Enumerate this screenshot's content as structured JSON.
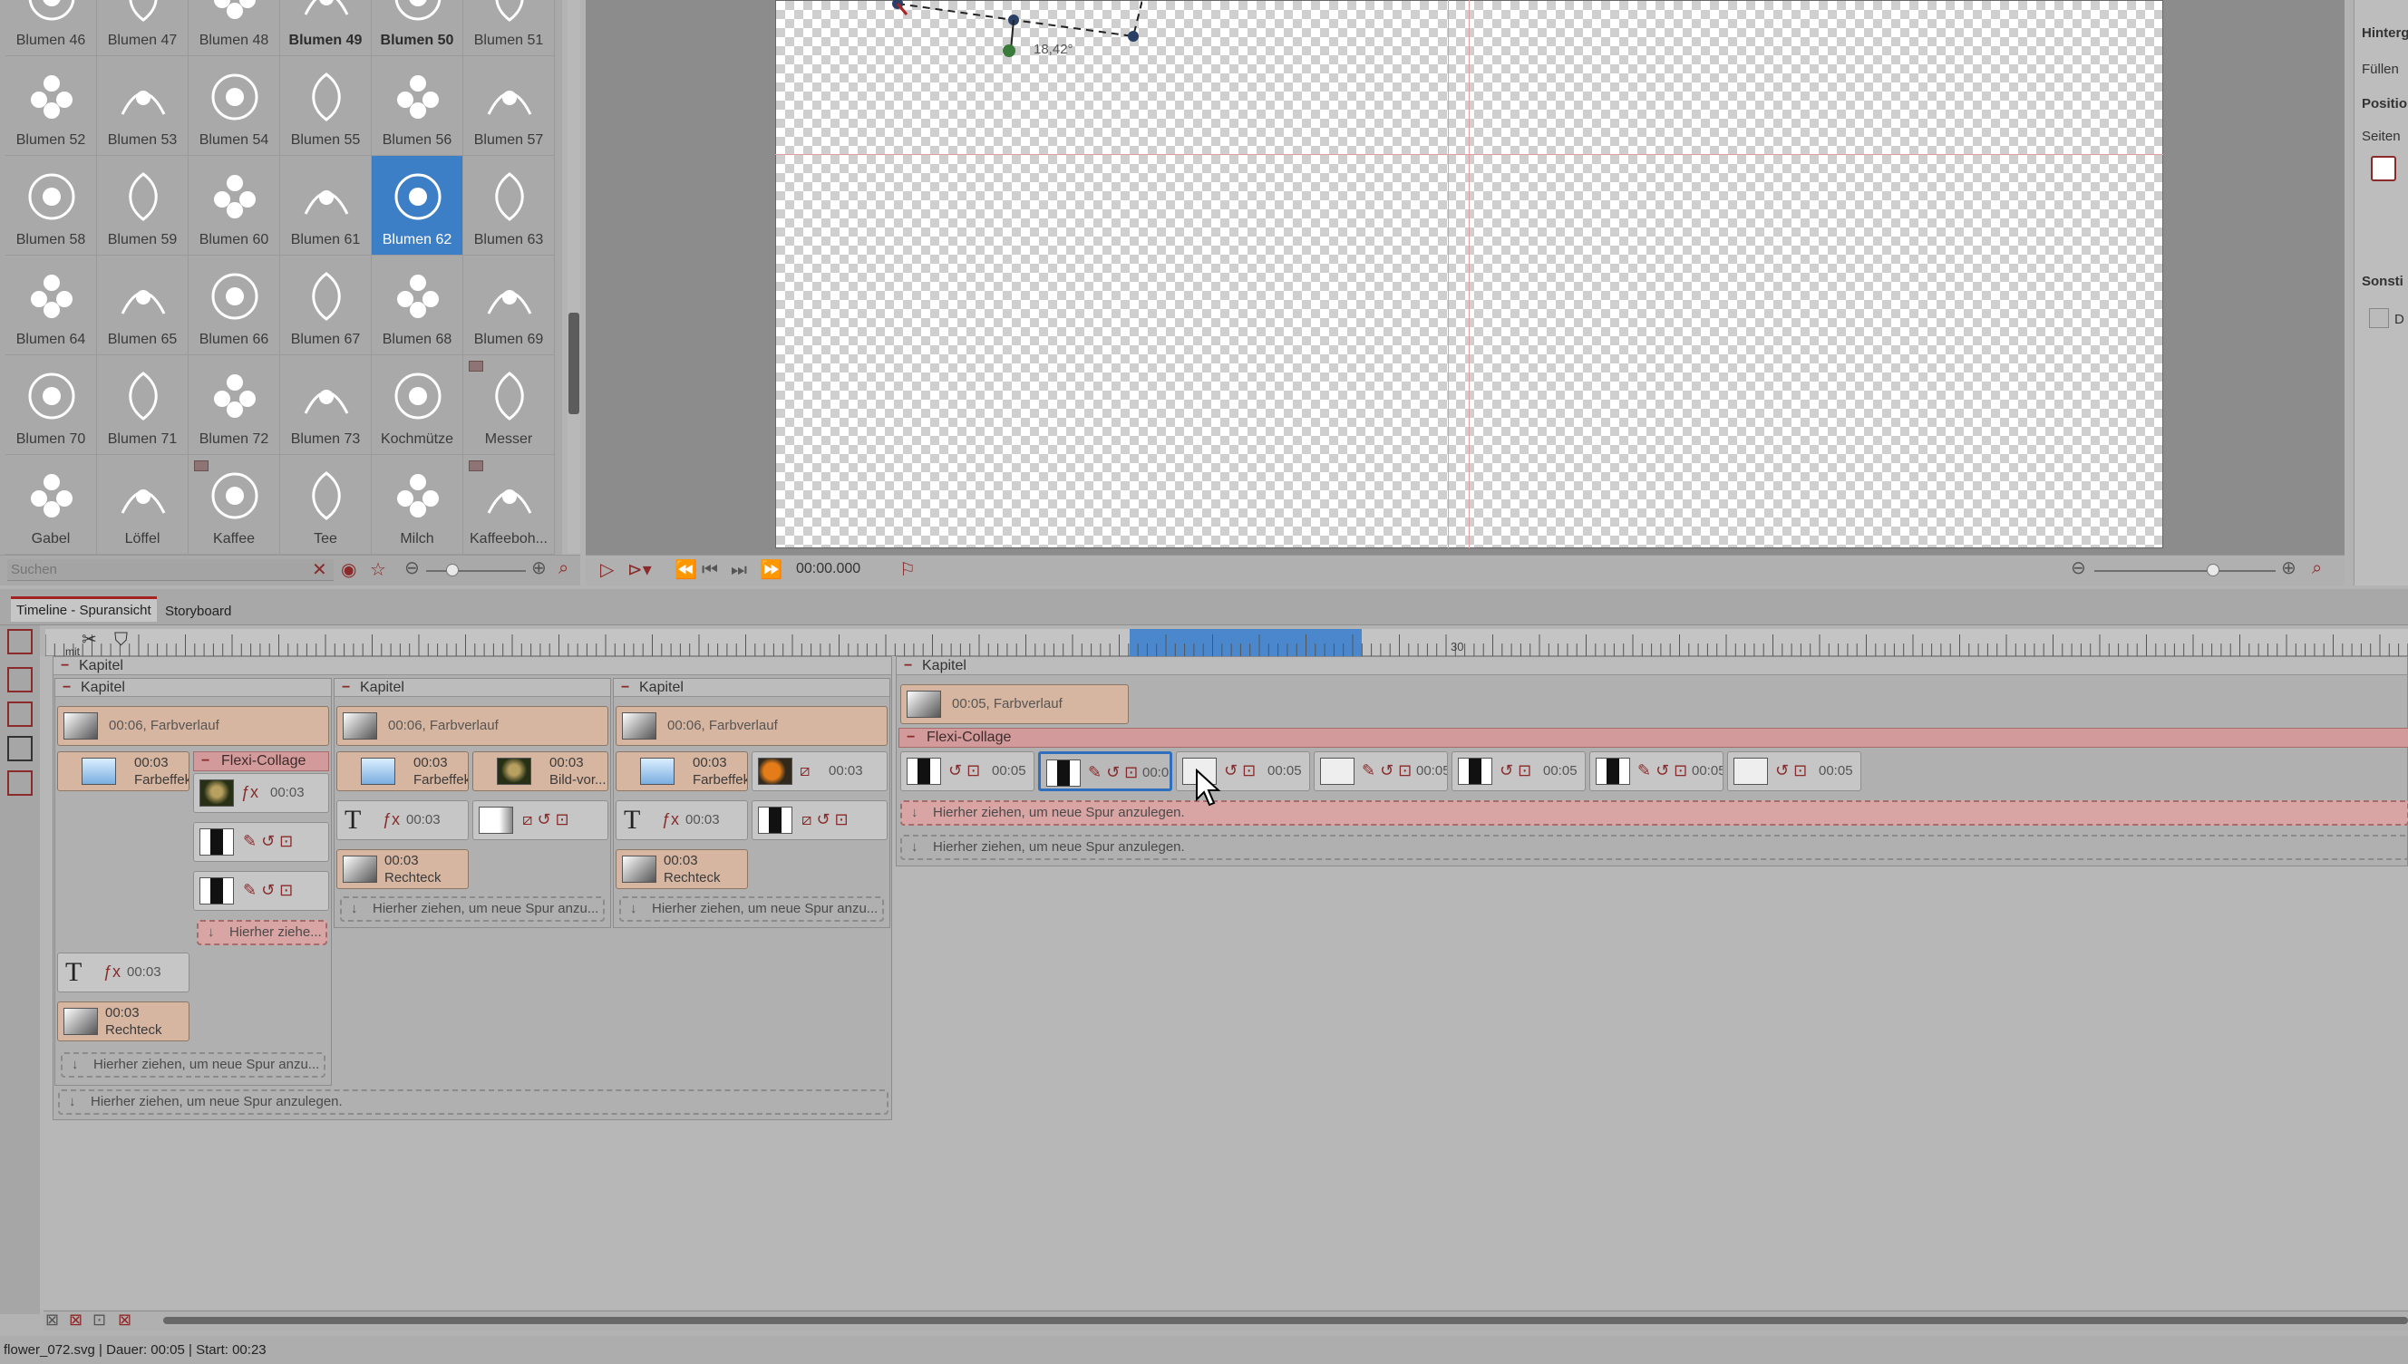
{
  "library": {
    "items": [
      "Blumen 46",
      "Blumen 47",
      "Blumen 48",
      "Blumen 49",
      "Blumen 50",
      "Blumen 51",
      "Blumen 52",
      "Blumen 53",
      "Blumen 54",
      "Blumen 55",
      "Blumen 56",
      "Blumen 57",
      "Blumen 58",
      "Blumen 59",
      "Blumen 60",
      "Blumen 61",
      "Blumen 62",
      "Blumen 63",
      "Blumen 64",
      "Blumen 65",
      "Blumen 66",
      "Blumen 67",
      "Blumen 68",
      "Blumen 69",
      "Blumen 70",
      "Blumen 71",
      "Blumen 72",
      "Blumen 73",
      "Kochmütze",
      "Messer",
      "Gabel",
      "Löffel",
      "Kaffee",
      "Tee",
      "Milch",
      "Kaffeeboh..."
    ],
    "selected": "Blumen 62",
    "search_placeholder": "Suchen"
  },
  "preview": {
    "timecode": "00:00.000",
    "angle_label": "18,42°"
  },
  "props": {
    "hintergrund": "Hinterg",
    "fuellen": "Füllen",
    "position": "Positio",
    "seiten": "Seiten",
    "sonstiges": "Sonsti",
    "check": "D"
  },
  "tabs": {
    "timeline": "Timeline - Spuransicht",
    "storyboard": "Storyboard"
  },
  "ruler": {
    "tick_30": "30",
    "marker": "mit"
  },
  "timeline": {
    "kapitel": "Kapitel",
    "farbverlauf6": "00:06, Farbverlauf",
    "farbverlauf5": "00:05, Farbverlauf",
    "flexi": "Flexi-Collage",
    "t003": "00:03",
    "t005": "00:05",
    "farbeffekt": "Farbeffekt",
    "rechteck": "Rechteck",
    "bildvor": "Bild-vor...",
    "drop_short": "Hierher ziehe...",
    "drop_mid": "Hierher ziehen, um neue Spur anzu...",
    "drop_full": "Hierher ziehen, um neue Spur anzulegen."
  },
  "status": "flower_072.svg | Dauer: 00:05 | Start: 00:23"
}
